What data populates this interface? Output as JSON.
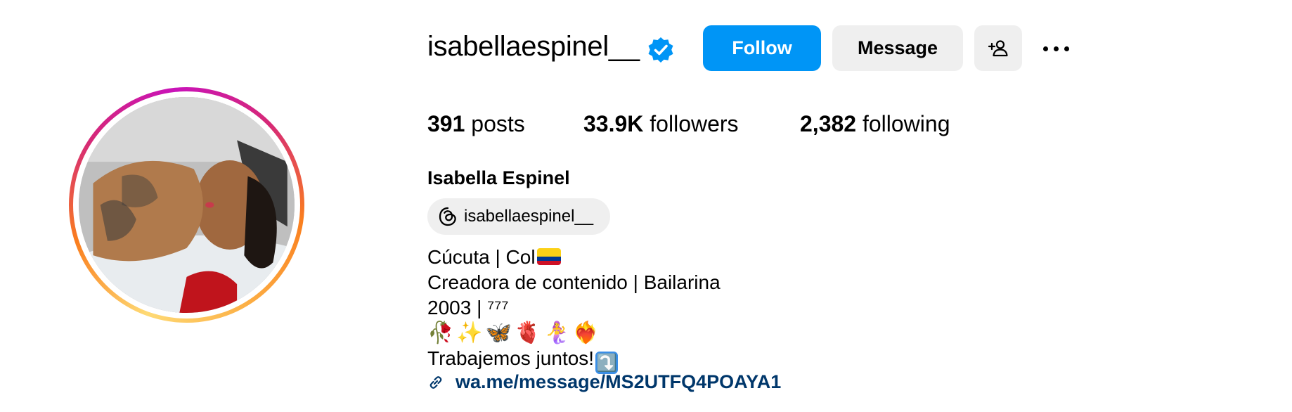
{
  "profile": {
    "username": "isabellaespinel__",
    "verified_icon": "verified-badge-icon",
    "full_name": "Isabella Espinel",
    "threads_handle": "isabellaespinel__"
  },
  "actions": {
    "follow_label": "Follow",
    "message_label": "Message",
    "add_user_icon": "add-user-icon",
    "more_icon": "more-options-icon"
  },
  "stats": {
    "posts_count": "391",
    "posts_label": "posts",
    "followers_count": "33.9K",
    "followers_label": "followers",
    "following_count": "2,382",
    "following_label": "following"
  },
  "bio": {
    "line1": "Cúcuta | Col",
    "line1_flag": "colombia-flag-emoji",
    "line2": "Creadora de contenido | Bailarina",
    "line3": "2003 | ⁷⁷⁷",
    "emojis": [
      "🥀",
      "✨",
      "🦋",
      "🫀",
      "🧜‍♀️",
      "❤️‍🔥"
    ],
    "line5": "Trabajemos juntos!",
    "line5_emoji": "⤵️"
  },
  "link": {
    "icon": "link-icon",
    "url": "wa.me/message/MS2UTFQ4POAYA1"
  },
  "colors": {
    "primary_button": "#0095f6",
    "secondary_button": "#efefef",
    "link_text": "#00376b",
    "verified_badge": "#0095f6"
  }
}
